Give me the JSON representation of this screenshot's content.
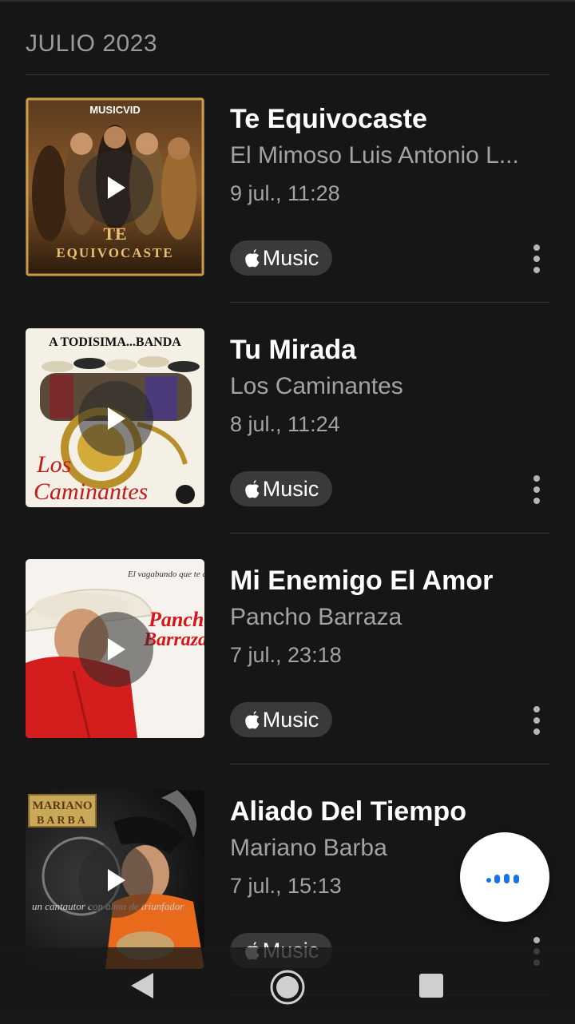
{
  "section": {
    "header": "JULIO 2023"
  },
  "tracks": [
    {
      "title": "Te Equivocaste",
      "artist": "El Mimoso Luis Antonio L...",
      "date": "9 jul., 11:28",
      "service": "Music",
      "cover_texts": [
        "MUSICVID",
        "TE",
        "EQUIVOCASTE"
      ]
    },
    {
      "title": "Tu Mirada",
      "artist": "Los Caminantes",
      "date": "8 jul., 11:24",
      "service": "Music",
      "cover_texts": [
        "A TODISIMA...BANDA",
        "Los",
        "Caminantes"
      ]
    },
    {
      "title": "Mi Enemigo El Amor",
      "artist": "Pancho Barraza",
      "date": "7 jul., 23:18",
      "service": "Music",
      "cover_texts": [
        "El vagabundo que te ama",
        "Pancho",
        "Barraza"
      ]
    },
    {
      "title": "Aliado Del Tiempo",
      "artist": "Mariano Barba",
      "date": "7 jul., 15:13",
      "service": "Music",
      "cover_texts": [
        "MARIANO",
        "BARBA",
        "un cantautor con alma de triunfador"
      ]
    }
  ],
  "icons": {
    "play": "play-icon",
    "apple": "apple-logo-icon",
    "more": "more-vertical-icon",
    "fab": "listening-dots-icon",
    "nav_back": "back-icon",
    "nav_home": "home-icon",
    "nav_recent": "recents-icon"
  },
  "colors": {
    "background": "#161616",
    "secondary_text": "#a3a3a3",
    "badge": "#3a3a3a",
    "accent": "#1a73e8"
  }
}
